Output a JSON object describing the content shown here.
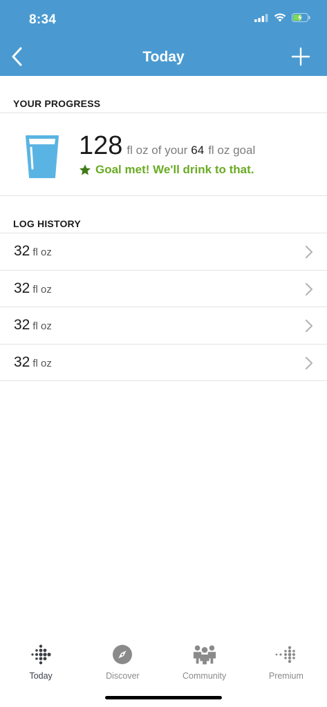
{
  "status_bar": {
    "time": "8:34"
  },
  "nav": {
    "title": "Today"
  },
  "colors": {
    "header": "#4a9ad1",
    "success": "#6aab24",
    "glass": "#5ab4e3"
  },
  "progress": {
    "section_label": "YOUR PROGRESS",
    "amount": "128",
    "unit_text": "fl oz of your",
    "goal_amount": "64",
    "goal_unit": "fl oz goal",
    "goal_status": "Goal met! We'll drink to that."
  },
  "log_history": {
    "section_label": "LOG HISTORY",
    "entries": [
      {
        "amount": "32",
        "unit": "fl oz"
      },
      {
        "amount": "32",
        "unit": "fl oz"
      },
      {
        "amount": "32",
        "unit": "fl oz"
      },
      {
        "amount": "32",
        "unit": "fl oz"
      }
    ]
  },
  "tabs": [
    {
      "label": "Today",
      "icon": "fitbit-dots-icon",
      "active": true
    },
    {
      "label": "Discover",
      "icon": "compass-icon",
      "active": false
    },
    {
      "label": "Community",
      "icon": "community-icon",
      "active": false
    },
    {
      "label": "Premium",
      "icon": "premium-dots-icon",
      "active": false
    }
  ]
}
